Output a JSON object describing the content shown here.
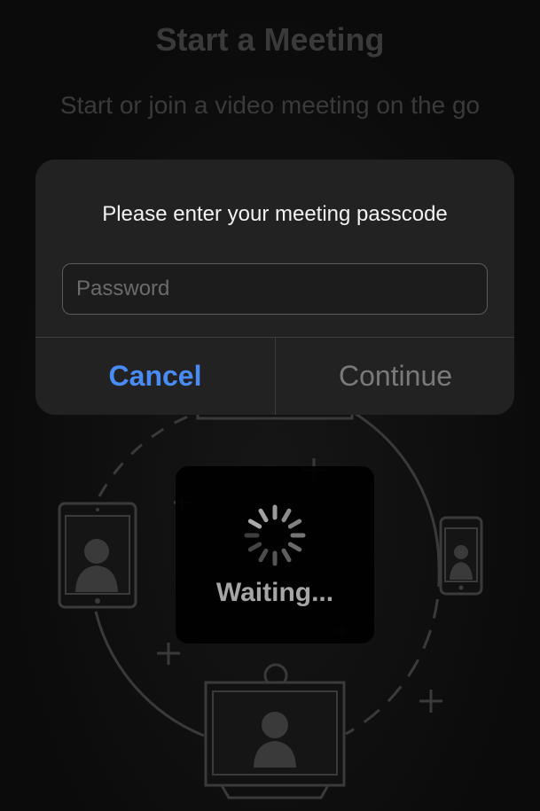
{
  "screen": {
    "title": "Start a Meeting",
    "subtitle": "Start or join a video meeting on the go"
  },
  "dialog": {
    "message": "Please enter your meeting passcode",
    "password_placeholder": "Password",
    "password_value": "",
    "cancel_label": "Cancel",
    "continue_label": "Continue"
  },
  "hud": {
    "waiting_label": "Waiting..."
  },
  "colors": {
    "background": "#0b0b0b",
    "dialog_background": "#222222",
    "accent_blue": "#4a8cf7",
    "disabled_text": "#7a7a7a",
    "illustration_stroke": "#3a3a3a"
  },
  "icons": [
    "tablet-icon",
    "phone-icon",
    "monitor-icon",
    "plus-icon",
    "spinner-icon",
    "person-icon"
  ]
}
